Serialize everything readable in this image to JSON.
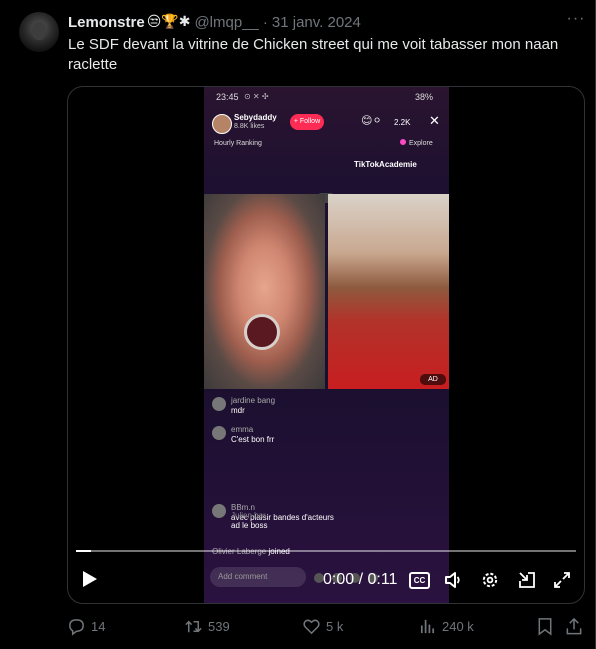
{
  "tweet": {
    "author_name": "Lemonstre",
    "author_emojis": "😒🏆✱",
    "handle": "@lmqp__",
    "separator": "·",
    "date": "31 janv. 2024",
    "more_label": "···",
    "text": "Le SDF devant la vitrine de Chicken street qui me voit tabasser mon naan raclette"
  },
  "video": {
    "status_time": "23:45",
    "status_battery": "38%",
    "host_name": "Sebydaddy",
    "host_likes": "8.8K likes",
    "follow_label": "+ Follow",
    "viewer_count": "2.2K",
    "ranking_label": "Hourly Ranking",
    "explore_label": "Explore",
    "brand_label": "TikTokAcademie",
    "ad_label": "AD",
    "comments": [
      {
        "user": "jardine bang",
        "message": "mdr"
      },
      {
        "user": "emma",
        "message": "C'est bon frr"
      },
      {
        "user": "BBm.n",
        "message": "avec plaisir bandes d'acteurs"
      },
      {
        "user": "Julien bar",
        "message": "ad le boss"
      }
    ],
    "joined_user": "Olivier Laberge",
    "joined_label": "joined",
    "add_comment_placeholder": "Add comment",
    "progress_fraction": 0.03,
    "timecode": "0:00 / 0:11",
    "cc_label": "CC"
  },
  "actions": {
    "replies": "14",
    "reposts": "539",
    "likes": "5 k",
    "views": "240 k"
  }
}
